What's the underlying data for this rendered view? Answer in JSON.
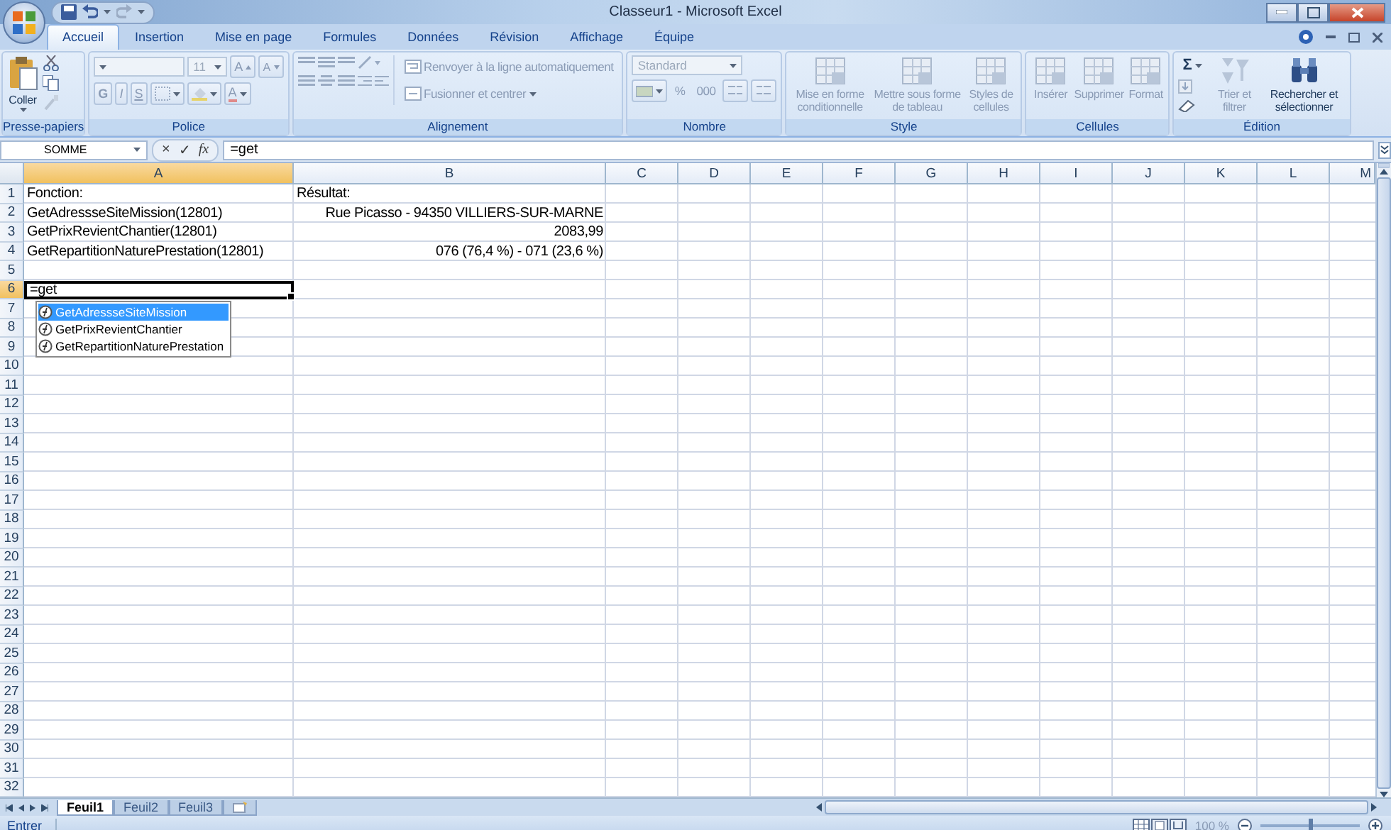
{
  "window": {
    "title": "Classeur1 - Microsoft Excel"
  },
  "tabs": [
    {
      "label": "Accueil",
      "selected": true
    },
    {
      "label": "Insertion",
      "selected": false
    },
    {
      "label": "Mise en page",
      "selected": false
    },
    {
      "label": "Formules",
      "selected": false
    },
    {
      "label": "Données",
      "selected": false
    },
    {
      "label": "Révision",
      "selected": false
    },
    {
      "label": "Affichage",
      "selected": false
    },
    {
      "label": "Équipe",
      "selected": false
    }
  ],
  "ribbon": {
    "groups": [
      {
        "kind": "clipboard",
        "label": "Presse-papiers",
        "paste": "Coller"
      },
      {
        "kind": "font",
        "label": "Police",
        "size": "11",
        "grow": "A",
        "shrink": "A",
        "bold": "G",
        "italic": "I",
        "underline": "S",
        "font_color": "A"
      },
      {
        "kind": "alignment",
        "label": "Alignement",
        "wrap": "Renvoyer à la ligne automatiquement",
        "merge": "Fusionner et centrer"
      },
      {
        "kind": "number",
        "label": "Nombre",
        "format": "Standard",
        "percent": "%",
        "thousands": "000"
      },
      {
        "kind": "style",
        "label": "Style",
        "buttons": [
          {
            "label": "Mise en forme conditionnelle",
            "disabled": true
          },
          {
            "label": "Mettre sous forme de tableau",
            "disabled": true
          },
          {
            "label": "Styles de cellules",
            "disabled": true
          }
        ]
      },
      {
        "kind": "cells",
        "label": "Cellules",
        "buttons": [
          {
            "label": "Insérer",
            "disabled": true
          },
          {
            "label": "Supprimer",
            "disabled": true
          },
          {
            "label": "Format",
            "disabled": true
          }
        ]
      },
      {
        "kind": "editing",
        "label": "Édition",
        "sigma": "Σ",
        "buttons": [
          {
            "label": "Trier et filtrer",
            "disabled": true
          },
          {
            "label": "Rechercher et sélectionner",
            "disabled": false
          }
        ]
      }
    ]
  },
  "formula_bar": {
    "name_box": "SOMME",
    "cancel": "×",
    "enter": "✓",
    "fx": "fx",
    "value": "=get"
  },
  "columns": [
    {
      "label": "A",
      "selected": true
    },
    {
      "label": "B",
      "selected": false
    },
    {
      "label": "C",
      "selected": false
    },
    {
      "label": "D",
      "selected": false
    },
    {
      "label": "E",
      "selected": false
    },
    {
      "label": "F",
      "selected": false
    },
    {
      "label": "G",
      "selected": false
    },
    {
      "label": "H",
      "selected": false
    },
    {
      "label": "I",
      "selected": false
    },
    {
      "label": "J",
      "selected": false
    },
    {
      "label": "K",
      "selected": false
    },
    {
      "label": "L",
      "selected": false
    },
    {
      "label": "M",
      "selected": false
    }
  ],
  "rows": [
    {
      "label": "1",
      "selected": false,
      "cells": [
        {
          "text": "Fonction:",
          "right_aligned": false,
          "editing": false
        },
        {
          "text": "Résultat:",
          "right_aligned": false,
          "editing": false
        }
      ]
    },
    {
      "label": "2",
      "selected": false,
      "cells": [
        {
          "text": "GetAdressseSiteMission(12801)",
          "right_aligned": false,
          "editing": false
        },
        {
          "text": "Rue Picasso - 94350 VILLIERS-SUR-MARNE",
          "right_aligned": true,
          "editing": false
        }
      ]
    },
    {
      "label": "3",
      "selected": false,
      "cells": [
        {
          "text": "GetPrixRevientChantier(12801)",
          "right_aligned": false,
          "editing": false
        },
        {
          "text": "2083,99",
          "right_aligned": true,
          "editing": false
        }
      ]
    },
    {
      "label": "4",
      "selected": false,
      "cells": [
        {
          "text": "GetRepartitionNaturePrestation(12801)",
          "right_aligned": false,
          "editing": false
        },
        {
          "text": "076 (76,4 %) - 071 (23,6 %)",
          "right_aligned": true,
          "editing": false
        }
      ]
    },
    {
      "label": "5",
      "selected": false
    },
    {
      "label": "6",
      "selected": true,
      "cells": [
        {
          "text": "=get",
          "right_aligned": false,
          "editing": true
        }
      ]
    },
    {
      "label": "7",
      "selected": false
    },
    {
      "label": "8",
      "selected": false
    },
    {
      "label": "9",
      "selected": false
    },
    {
      "label": "10",
      "selected": false
    },
    {
      "label": "11",
      "selected": false
    },
    {
      "label": "12",
      "selected": false
    },
    {
      "label": "13",
      "selected": false
    },
    {
      "label": "14",
      "selected": false
    },
    {
      "label": "15",
      "selected": false
    },
    {
      "label": "16",
      "selected": false
    },
    {
      "label": "17",
      "selected": false
    },
    {
      "label": "18",
      "selected": false
    },
    {
      "label": "19",
      "selected": false
    },
    {
      "label": "20",
      "selected": false
    },
    {
      "label": "21",
      "selected": false
    },
    {
      "label": "22",
      "selected": false
    },
    {
      "label": "23",
      "selected": false
    },
    {
      "label": "24",
      "selected": false
    },
    {
      "label": "25",
      "selected": false
    },
    {
      "label": "26",
      "selected": false
    },
    {
      "label": "27",
      "selected": false
    },
    {
      "label": "28",
      "selected": false
    },
    {
      "label": "29",
      "selected": false
    },
    {
      "label": "30",
      "selected": false
    },
    {
      "label": "31",
      "selected": false
    },
    {
      "label": "32",
      "selected": false
    }
  ],
  "autocomplete": [
    {
      "label": "GetAdressseSiteMission",
      "selected": true
    },
    {
      "label": "GetPrixRevientChantier",
      "selected": false
    },
    {
      "label": "GetRepartitionNaturePrestation",
      "selected": false
    }
  ],
  "sheet_tabs": [
    {
      "label": "Feuil1",
      "selected": true
    },
    {
      "label": "Feuil2",
      "selected": false
    },
    {
      "label": "Feuil3",
      "selected": false
    }
  ],
  "status_bar": {
    "mode": "Entrer",
    "zoom": {
      "label": "100 %",
      "level": 0.5
    }
  }
}
